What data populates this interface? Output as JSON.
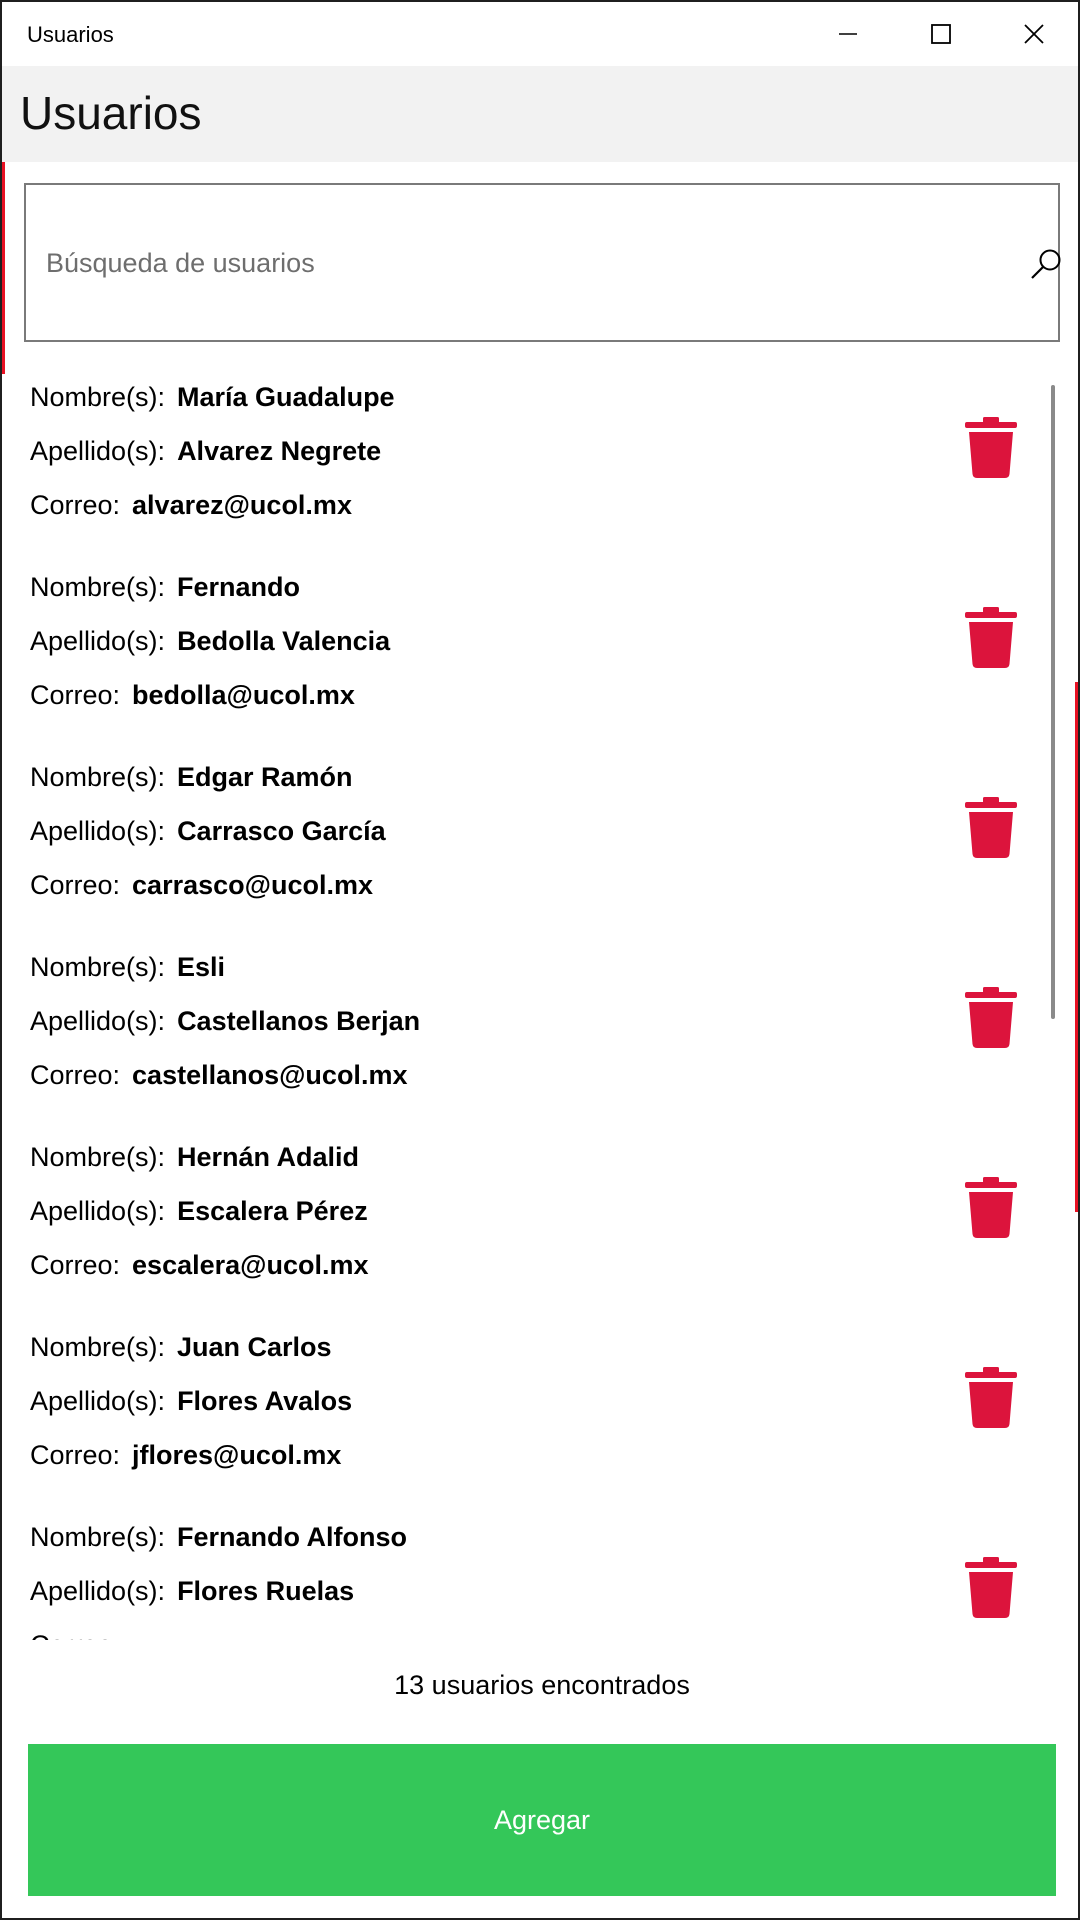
{
  "window": {
    "title": "Usuarios"
  },
  "header": {
    "title": "Usuarios"
  },
  "search": {
    "placeholder": "Búsqueda de usuarios",
    "value": ""
  },
  "labels": {
    "nombre": "Nombre(s):",
    "apellido": "Apellido(s):",
    "correo": "Correo:"
  },
  "users": [
    {
      "nombre": "María Guadalupe",
      "apellido": "Alvarez Negrete",
      "correo": "alvarez@ucol.mx"
    },
    {
      "nombre": "Fernando",
      "apellido": "Bedolla Valencia",
      "correo": "bedolla@ucol.mx"
    },
    {
      "nombre": "Edgar Ramón",
      "apellido": "Carrasco García",
      "correo": "carrasco@ucol.mx"
    },
    {
      "nombre": "Esli",
      "apellido": "Castellanos Berjan",
      "correo": "castellanos@ucol.mx"
    },
    {
      "nombre": "Hernán Adalid",
      "apellido": "Escalera Pérez",
      "correo": "escalera@ucol.mx"
    },
    {
      "nombre": "Juan Carlos",
      "apellido": "Flores Avalos",
      "correo": "jflores@ucol.mx"
    },
    {
      "nombre": "Fernando Alfonso",
      "apellido": "Flores Ruelas",
      "correo": ""
    }
  ],
  "footer": {
    "count_text": "13 usuarios encontrados",
    "add_label": "Agregar"
  },
  "icons": {
    "delete": "trash-icon",
    "search": "search-icon"
  },
  "colors": {
    "accent_red": "#e81123",
    "delete_red": "#dc143c",
    "add_green": "#34c759"
  }
}
